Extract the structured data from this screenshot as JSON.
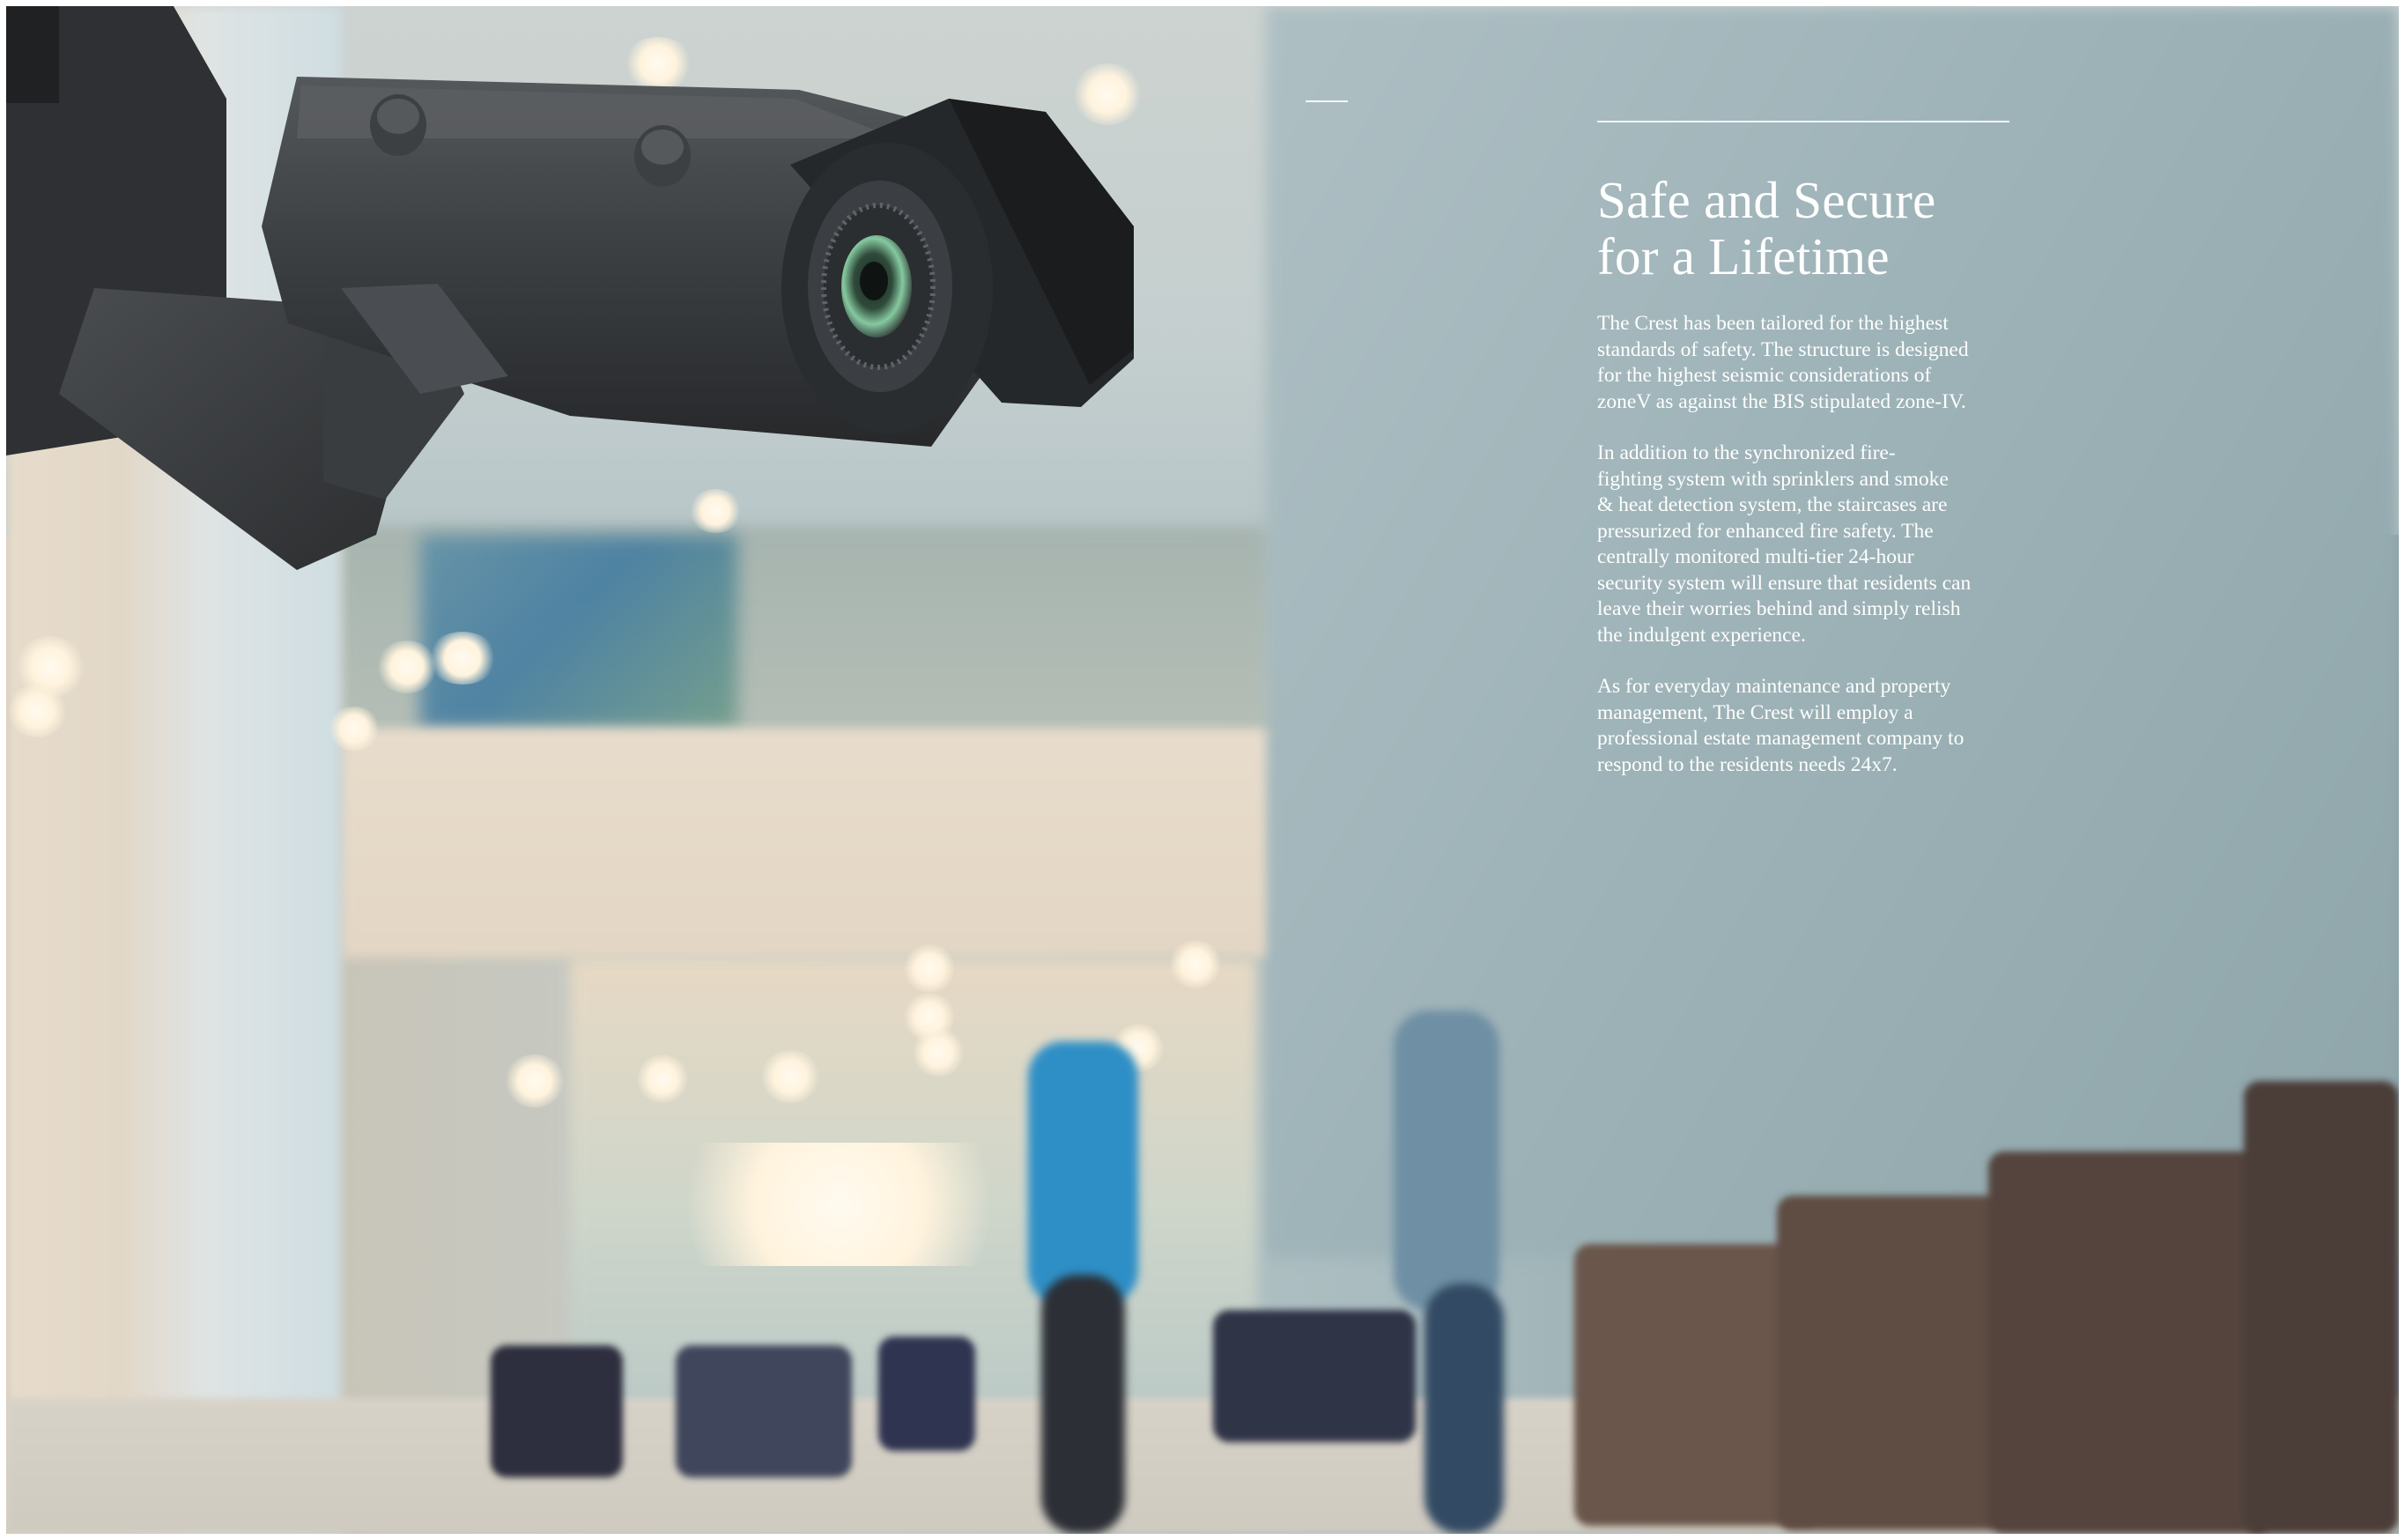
{
  "article": {
    "title_line1": "Safe and Secure",
    "title_line2": "for a Lifetime",
    "paragraphs": [
      "The Crest has been tailored for the highest\nstandards of safety. The structure is designed\nfor the highest seismic considerations of\nzoneV as against the BIS stipulated zone-IV.",
      "In addition to the synchronized fire-\nfighting system with sprinklers and smoke\n& heat detection system, the staircases are\npressurized for enhanced fire safety.  The\ncentrally monitored multi-tier 24-hour\nsecurity system will ensure that residents can\nleave their worries behind and simply relish\nthe indulgent experience.",
      "As for everyday maintenance and property\nmanagement, The Crest will employ a\nprofessional estate management company to\nrespond to the residents needs 24x7."
    ]
  },
  "photo": {
    "subject": "cctv-security-camera",
    "background": "blurred-residential-lobby"
  },
  "colors": {
    "text": "#ffffff",
    "camera_body": "#3a3c3e",
    "lens_ring": "#6fb08a"
  }
}
